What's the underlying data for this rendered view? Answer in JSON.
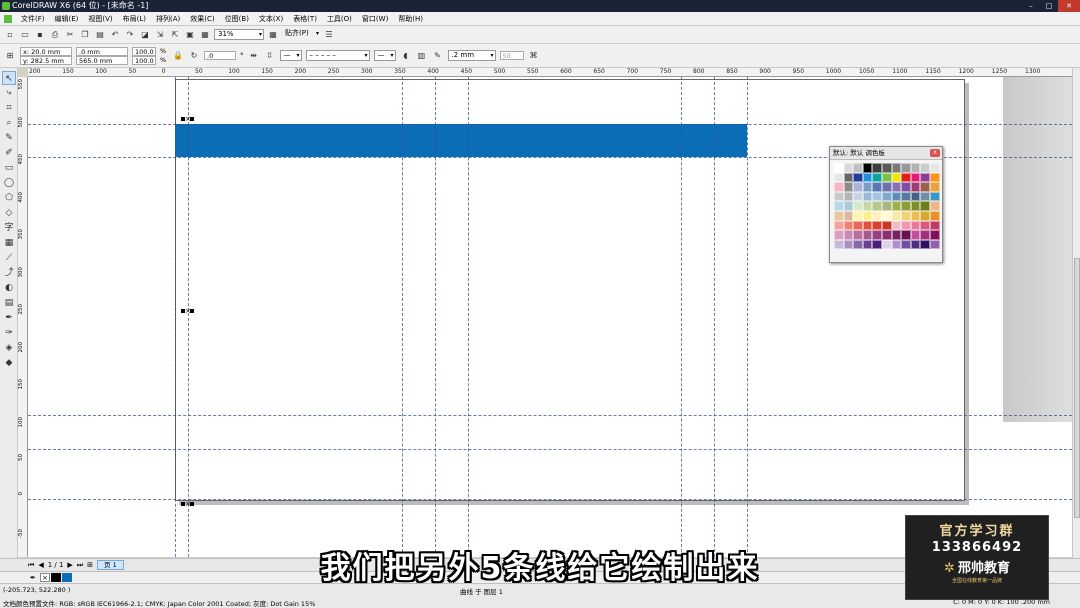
{
  "window": {
    "title": "CorelDRAW X6 (64 位) - [未命名 -1]",
    "minimize_label": "–",
    "maximize_label": "□",
    "close_label": "✕"
  },
  "menu": [
    "文件(F)",
    "编辑(E)",
    "视图(V)",
    "布局(L)",
    "排列(A)",
    "效果(C)",
    "位图(B)",
    "文本(X)",
    "表格(T)",
    "工具(O)",
    "窗口(W)",
    "帮助(H)"
  ],
  "toolbar": {
    "zoom": "31%",
    "snap": "贴齐(P)"
  },
  "propbar": {
    "x": "x: 20.0 mm",
    "y": "y: 282.5 mm",
    "w": ".0 mm",
    "h": "565.0 mm",
    "sx": "100.0",
    "sy": "100.0",
    "pct": "%",
    "angle": ".0",
    "deg": "°",
    "outline": ".2 mm",
    "miter": "50"
  },
  "ruler_h": [
    "200",
    "150",
    "100",
    "50",
    "0",
    "50",
    "100",
    "150",
    "200",
    "250",
    "300",
    "350",
    "400",
    "450",
    "500",
    "550",
    "600",
    "650",
    "700",
    "750",
    "800",
    "850",
    "900",
    "950",
    "1000",
    "1050",
    "1100",
    "1150",
    "1200",
    "1250",
    "1300"
  ],
  "ruler_v": [
    "550",
    "500",
    "450",
    "400",
    "350",
    "300",
    "250",
    "200",
    "150",
    "100",
    "50",
    "0",
    "-50"
  ],
  "palette": {
    "title": "默认: 默认 调色板",
    "close": "x",
    "colors": [
      "#ffffff",
      "#d9d9d9",
      "#bfbfbf",
      "#000000",
      "#3d3d3d",
      "#595959",
      "#7a7a7a",
      "#999999",
      "#b3b3b3",
      "#cccccc",
      "#e6e6e6",
      "#e6e6e6",
      "#666666",
      "#1f3f9a",
      "#1f8fd6",
      "#0fa2a0",
      "#7dc242",
      "#f4e400",
      "#e11c1c",
      "#e51b7b",
      "#8c3b96",
      "#f7931e",
      "#f4b6c2",
      "#8c8c8c",
      "#aab4d6",
      "#7a9cc6",
      "#5a78b3",
      "#6f6fb0",
      "#8a6fb0",
      "#7f4fa1",
      "#a13b74",
      "#9b5f50",
      "#e9a23b",
      "#c9c9c9",
      "#b4b4b4",
      "#c7d4e6",
      "#9fb8d9",
      "#a6c4e4",
      "#7fa9d1",
      "#5d8ab8",
      "#5878a0",
      "#426280",
      "#6f8ea6",
      "#3e96c6",
      "#b6d8e8",
      "#a8c9d8",
      "#d6e9c9",
      "#c6d9a9",
      "#b6c98a",
      "#a8b77e",
      "#9db04a",
      "#8d9e3a",
      "#7c8e2a",
      "#6a7e1a",
      "#f0b48a",
      "#e8c89a",
      "#d8b8a0",
      "#fff3b0",
      "#ffee90",
      "#fff0c0",
      "#fffad0",
      "#f8e8a8",
      "#f0d078",
      "#e8c050",
      "#d8a830",
      "#e8902a",
      "#f2a3a0",
      "#f08070",
      "#e86858",
      "#e05040",
      "#d84030",
      "#c83828",
      "#f6b8c8",
      "#f098b0",
      "#e87898",
      "#d85880",
      "#c03868",
      "#d9a0c0",
      "#c888b0",
      "#b870a0",
      "#a85890",
      "#984080",
      "#883070",
      "#782060",
      "#681050",
      "#c0509a",
      "#a0307a",
      "#80105a",
      "#c8b8d8",
      "#a890c0",
      "#8868a8",
      "#684090",
      "#482078",
      "#e0d0e8",
      "#b090c8",
      "#7050a0",
      "#503080",
      "#301060",
      "#9060b0"
    ]
  },
  "page_bar": {
    "counter": "1 / 1",
    "tab": "页 1"
  },
  "status": {
    "coords": "(-205.723, 522.280 )",
    "layer": "曲线 于 图层 1",
    "doc_profile": "文档颜色预置文件: RGB: sRGB IEC61966-2.1; CMYK: Japan Color 2001 Coated; 灰度: Dot Gain 15%",
    "fill": "C: 0 M: 0 Y: 0 K: 100  .200 mm"
  },
  "subtitle": "我们把另外5条线给它绘制出来",
  "promo": {
    "line1": "官方学习群",
    "line2": "133866492",
    "line3": "邢帅教育",
    "line4": "全国在线教育第一品牌"
  }
}
